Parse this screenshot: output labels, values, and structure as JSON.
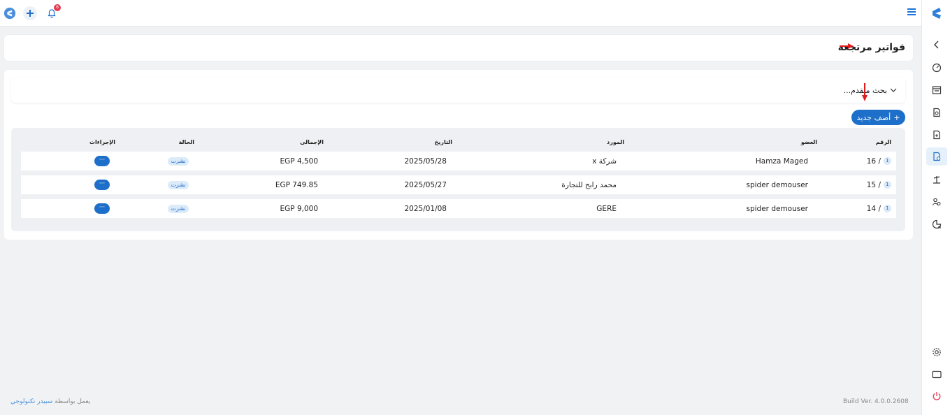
{
  "topbar": {
    "notification_count": "6"
  },
  "header": {
    "title": "فواتير مرتجعة"
  },
  "search": {
    "label": "بحث متقدم..."
  },
  "toolbar": {
    "add_label": "أضف جديد"
  },
  "table": {
    "headers": {
      "number": "الرقم",
      "member": "العضو",
      "supplier": "المورد",
      "date": "التاريخ",
      "total": "الإجمالى",
      "status": "الحالة",
      "actions": "الإجراءات"
    },
    "rows": [
      {
        "badge": "1",
        "number": "16 /",
        "member": "Hamza Maged",
        "supplier": "شركة x",
        "date": "2025/05/28",
        "total": "EGP 4,500",
        "status": "نشرت",
        "action": "···"
      },
      {
        "badge": "1",
        "number": "15 /",
        "member": "spider demouser",
        "supplier": "محمد رابح للتجارة",
        "date": "2025/05/27",
        "total": "EGP 749.85",
        "status": "نشرت",
        "action": "···"
      },
      {
        "badge": "1",
        "number": "14 /",
        "member": "spider demouser",
        "supplier": "GERE",
        "date": "2025/01/08",
        "total": "EGP 9,000",
        "status": "نشرت",
        "action": "···"
      }
    ]
  },
  "footer": {
    "build": "Build Ver. 4.0.0.2608",
    "powered_prefix": "يعمل بواسطة",
    "powered_link": "سبيدر تكنولوجي"
  },
  "colors": {
    "primary": "#1d6fc9",
    "badge_bg": "#dcebfa",
    "alert": "#e53b52"
  },
  "sidebar_icons": [
    "chevron-left-icon",
    "dashboard-icon",
    "invoice-list-icon",
    "search-doc-icon",
    "file-convert-icon",
    "returns-icon",
    "balance-icon",
    "users-icon",
    "reports-icon",
    "settings-icon",
    "window-icon",
    "power-icon"
  ]
}
